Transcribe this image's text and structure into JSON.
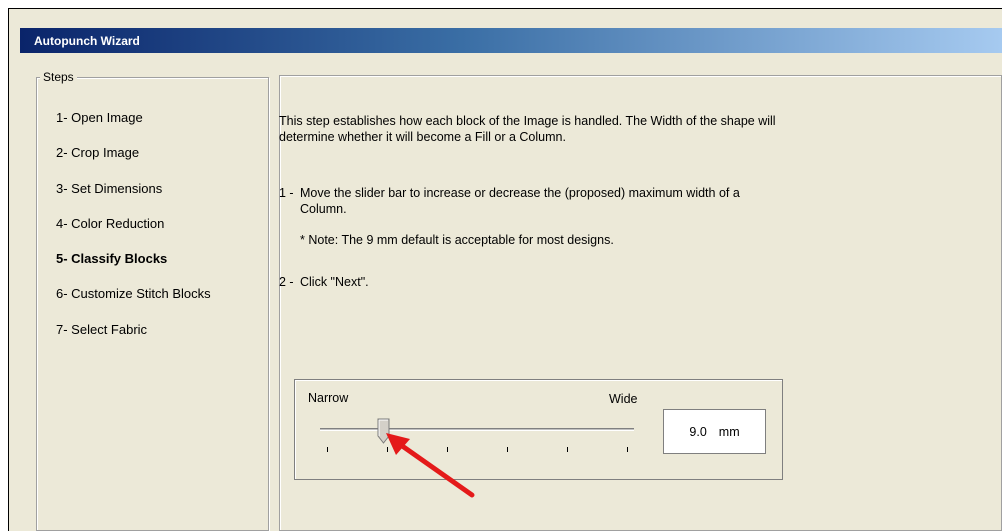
{
  "window": {
    "title": "Autopunch Wizard"
  },
  "steps": {
    "legend": "Steps",
    "items": [
      {
        "label": "1- Open Image",
        "active": false
      },
      {
        "label": "2- Crop Image",
        "active": false
      },
      {
        "label": "3- Set Dimensions",
        "active": false
      },
      {
        "label": "4- Color Reduction",
        "active": false
      },
      {
        "label": "5- Classify Blocks",
        "active": true
      },
      {
        "label": "6- Customize Stitch Blocks",
        "active": false
      },
      {
        "label": "7- Select Fabric",
        "active": false
      }
    ]
  },
  "content": {
    "intro": "This step establishes how each block of the Image is handled. The Width of the shape will determine whether it will become a Fill or a Column.",
    "step1_number": "1 -",
    "step1_text": "Move the slider bar to increase or decrease the (proposed) maximum width of a Column.",
    "note": "* Note: The 9 mm default is acceptable for most designs.",
    "step2_number": "2 -",
    "step2_text": "Click \"Next\"."
  },
  "slider": {
    "min_label": "Narrow",
    "max_label": "Wide",
    "value": "9.0",
    "unit": "mm",
    "position_fraction": 0.2,
    "tick_count": 6
  },
  "annotation": {
    "arrow_color": "#e41a1a",
    "arrow_icon": "red-arrow-pointer"
  }
}
